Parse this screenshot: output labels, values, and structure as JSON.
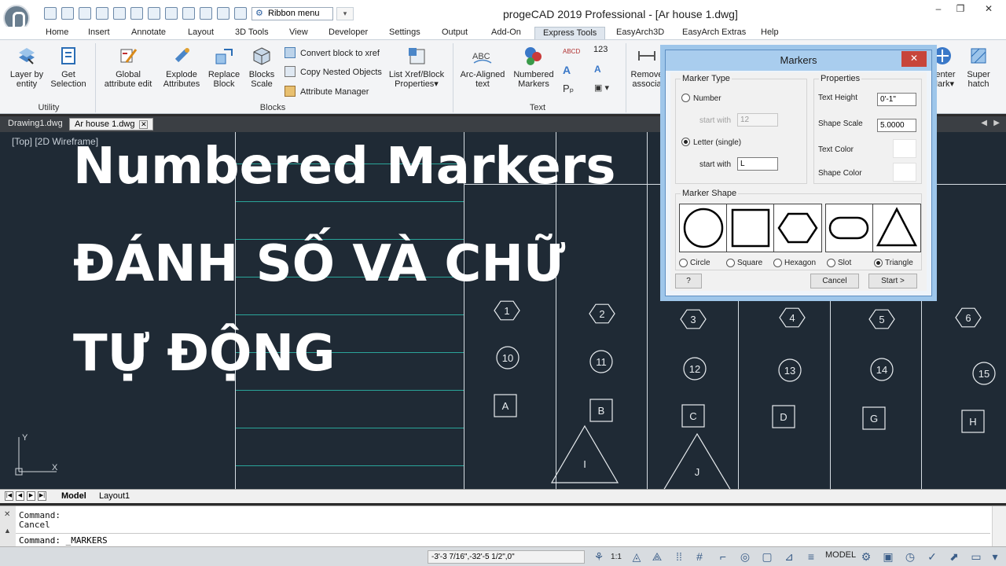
{
  "window": {
    "title": "progeCAD 2019 Professional - [Ar house 1.dwg]",
    "ribbon_menu": "Ribbon menu",
    "controls": [
      "–",
      "❐",
      "✕"
    ]
  },
  "tabs": [
    "Home",
    "Insert",
    "Annotate",
    "Layout",
    "3D Tools",
    "View",
    "Developer",
    "Settings",
    "Output",
    "Add-On",
    "Express Tools",
    "EasyArch3D",
    "EasyArch Extras",
    "Help"
  ],
  "active_tab": "Express Tools",
  "ribbon": {
    "utility": {
      "label": "Utility",
      "layer_by_entity": "Layer by entity",
      "get_selection": "Get Selection"
    },
    "blocks": {
      "label": "Blocks",
      "global_attr_edit": "Global attribute edit",
      "explode_attributes": "Explode Attributes",
      "replace_block": "Replace Block",
      "blocks_scale": "Blocks Scale",
      "convert_block": "Convert block to xref",
      "copy_nested": "Copy Nested Objects",
      "attribute_manager": "Attribute Manager",
      "list_xref": "List Xref/Block Properties▾"
    },
    "text": {
      "label": "Text",
      "arc_aligned": "Arc-Aligned text",
      "numbered_markers": "Numbered Markers",
      "arc_icon_text": "ABC",
      "abcd": "ABCD",
      "one_two_three": "123"
    },
    "right": {
      "remove_assoc": "Remove associa",
      "center_mark": "Center Mark▾",
      "super_hatch": "Super hatch"
    }
  },
  "doc_tabs": [
    "Drawing1.dwg",
    "Ar house 1.dwg"
  ],
  "doc_tab_close": "✕",
  "canvas": {
    "view_label": "[Top] [2D Wireframe]",
    "overlay_lines": [
      "Numbered Markers",
      "ĐÁNH SỐ VÀ CHỮ",
      "TỰ ĐỘNG"
    ],
    "ucs_y": "Y",
    "ucs_x": "X"
  },
  "markers": {
    "hexagons": [
      "1",
      "2",
      "3",
      "4",
      "5",
      "6"
    ],
    "circles": [
      "10",
      "11",
      "12",
      "13",
      "14",
      "15"
    ],
    "squares": [
      "A",
      "B",
      "C",
      "D",
      "G",
      "H"
    ],
    "triangles": [
      "I",
      "J"
    ]
  },
  "dialog": {
    "title": "Markers",
    "close": "✕",
    "marker_type": "Marker Type",
    "number": "Number",
    "start_with": "start with",
    "number_start": "12",
    "letter": "Letter (single)",
    "letter_start": "L",
    "properties": "Properties",
    "text_height": "Text Height",
    "text_height_value": "0'-1\"",
    "shape_scale": "Shape Scale",
    "shape_scale_value": "5.0000",
    "text_color": "Text Color",
    "shape_color": "Shape Color",
    "marker_shape": "Marker Shape",
    "shapes": [
      "Circle",
      "Square",
      "Hexagon",
      "Slot",
      "Triangle"
    ],
    "selected_shape": "Triangle",
    "help": "?",
    "cancel": "Cancel",
    "start": "Start >"
  },
  "layout_tabs": [
    "Model",
    "Layout1"
  ],
  "command": {
    "lines": [
      "Command:",
      "Cancel"
    ],
    "input": "Command: _MARKERS"
  },
  "status": {
    "coords": "-3'-3 7/16\",-32'-5 1/2\",0\"",
    "scale": "1:1",
    "model": "MODEL"
  }
}
